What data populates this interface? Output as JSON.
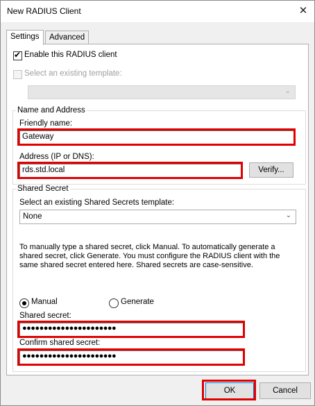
{
  "window": {
    "title": "New RADIUS Client",
    "close_glyph": "✕"
  },
  "tabs": [
    {
      "label": "Settings"
    },
    {
      "label": "Advanced"
    }
  ],
  "enable_client": {
    "label": "Enable this RADIUS client",
    "checked": true
  },
  "existing_template": {
    "label": "Select an existing template:",
    "checked": false,
    "enabled": false,
    "value": ""
  },
  "name_address": {
    "group_title": "Name and Address",
    "friendly_name_label": "Friendly name:",
    "friendly_name_value": "Gateway",
    "address_label": "Address (IP or DNS):",
    "address_value": "rds.std.local",
    "verify_button": "Verify..."
  },
  "shared_secret": {
    "group_title": "Shared Secret",
    "template_label": "Select an existing Shared Secrets template:",
    "template_value": "None",
    "instructions": "To manually type a shared secret, click Manual. To automatically generate a shared secret, click Generate. You must configure the RADIUS client with the same shared secret entered here. Shared secrets are case-sensitive.",
    "manual_label": "Manual",
    "generate_label": "Generate",
    "selected_mode": "Manual",
    "secret_label": "Shared secret:",
    "secret_value": "●●●●●●●●●●●●●●●●●●●●●●",
    "confirm_label": "Confirm shared secret:",
    "confirm_value": "●●●●●●●●●●●●●●●●●●●●●●"
  },
  "buttons": {
    "ok": "OK",
    "cancel": "Cancel"
  },
  "colors": {
    "highlight": "#e00000",
    "dialog_bg": "#f0f0f0"
  }
}
